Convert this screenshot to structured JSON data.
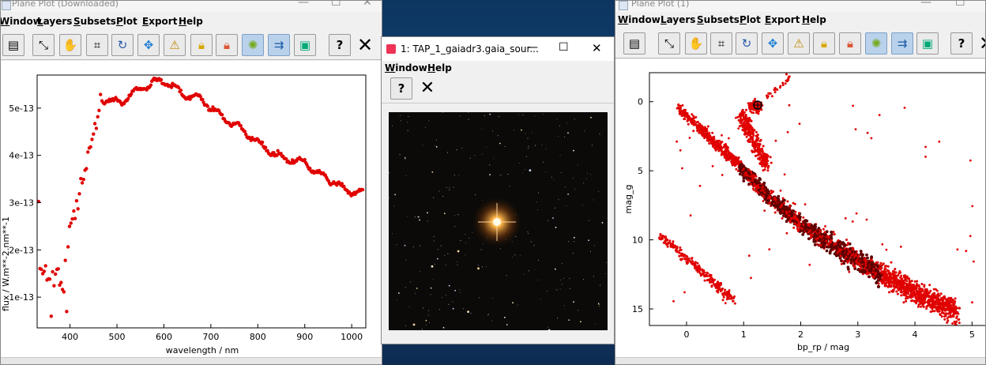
{
  "colors": {
    "point": "#e00000",
    "point_dense": "#600000",
    "menu_text": "#000000",
    "desk": "#16487c"
  },
  "left_window": {
    "title": "Plane Plot (Downloaded)",
    "menu": [
      "Window",
      "Layers",
      "Subsets",
      "Plot",
      "Export",
      "Help"
    ],
    "toolbar_icons": [
      "print-icon",
      "axis-zoom-icon",
      "hand-icon",
      "frame-icon",
      "reset-icon",
      "move-icon",
      "ruler-icon",
      "lock-icon",
      "lock-color-icon",
      "color-blobs-icon",
      "navigation-help-icon",
      "export-image-icon",
      "help-icon",
      "close-icon"
    ],
    "chart_data": {
      "type": "scatter",
      "xlabel": "wavelength / nm",
      "ylabel": "flux / W.m**-2.nm**-1",
      "xlim": [
        330,
        1030
      ],
      "ylim": [
        3.5e-14,
        5.7e-13
      ],
      "xticks": [
        "400",
        "500",
        "600",
        "700",
        "800",
        "900",
        "1000"
      ],
      "yticks": [
        "1e-13",
        "2e-13",
        "3e-13",
        "4e-13",
        "5e-13"
      ]
    }
  },
  "popup": {
    "title": "1: TAP_1_gaiadr3.gaia_sour...",
    "menu": [
      "Window",
      "Help"
    ],
    "buttons": [
      "help-icon",
      "close-icon"
    ]
  },
  "right_window": {
    "title": "Plane Plot (1)",
    "menu": [
      "Window",
      "Layers",
      "Subsets",
      "Plot",
      "Export",
      "Help"
    ],
    "chart_data": {
      "type": "scatter",
      "xlabel": "bp_rp / mag",
      "ylabel": "mag_g",
      "xlim": [
        -0.65,
        5.3
      ],
      "ylim": [
        16.2,
        -2.1
      ],
      "xticks": [
        "0",
        "1",
        "2",
        "3",
        "4",
        "5"
      ],
      "yticks": [
        "0",
        "5",
        "10",
        "15"
      ]
    }
  }
}
